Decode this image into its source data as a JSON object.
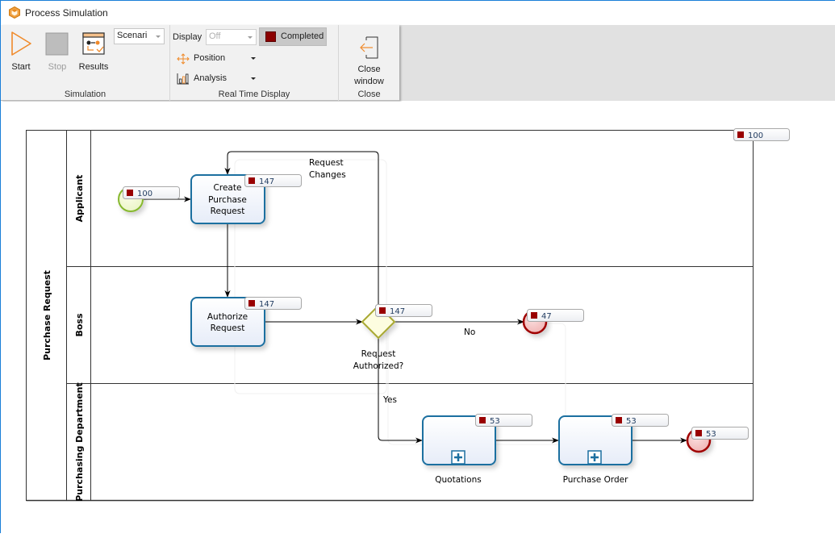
{
  "window": {
    "title": "Process Simulation",
    "accent_color": "#1a7fd8"
  },
  "ribbon": {
    "simulation": {
      "group_label": "Simulation",
      "start_label": "Start",
      "stop_label": "Stop",
      "results_label": "Results",
      "scenario_value": "Scenari"
    },
    "real_time_display": {
      "group_label": "Real Time Display",
      "display_label": "Display",
      "display_value": "Off",
      "completed_label": "Completed",
      "completed_color": "#8b0000",
      "position_label": "Position",
      "analysis_label": "Analysis"
    },
    "close": {
      "group_label": "Close",
      "close_window_line1": "Close",
      "close_window_line2": "window"
    }
  },
  "diagram": {
    "pool_label": "Purchase Request",
    "lanes": [
      {
        "label": "Applicant"
      },
      {
        "label": "Boss"
      },
      {
        "label": "Purchasing Department"
      }
    ],
    "pool_counter": "100",
    "start_event": {
      "counter": "100"
    },
    "tasks": {
      "create_purchase_request": {
        "line1": "Create",
        "line2": "Purchase",
        "line3": "Request",
        "counter": "147"
      },
      "authorize_request": {
        "line1": "Authorize",
        "line2": "Request",
        "counter": "147"
      },
      "quotations": {
        "label": "Quotations",
        "counter": "53"
      },
      "purchase_order": {
        "label": "Purchase Order",
        "counter": "53"
      }
    },
    "gateway": {
      "line1": "Request",
      "line2": "Authorized?",
      "counter": "147"
    },
    "end_event_rejected": {
      "counter": "47"
    },
    "end_event_completed": {
      "counter": "53"
    },
    "flows": {
      "request_changes_line1": "Request",
      "request_changes_line2": "Changes",
      "no_label": "No",
      "yes_label": "Yes"
    },
    "counter_color": "#990000"
  }
}
